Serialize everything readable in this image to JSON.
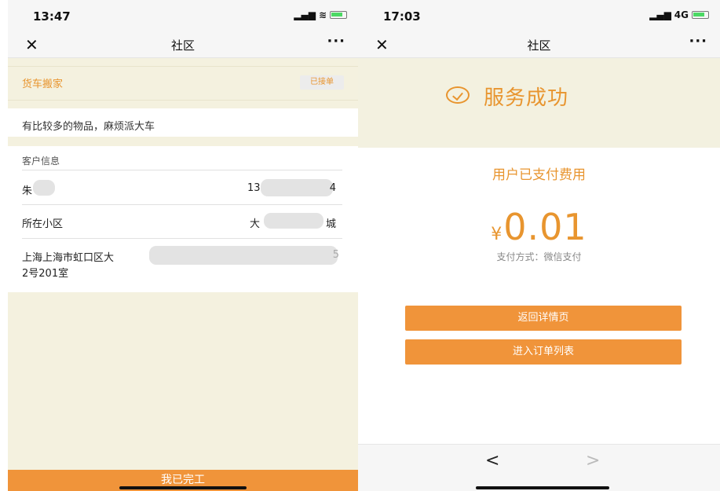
{
  "left_screen": {
    "status_bar": {
      "time": "13:47",
      "signal": "▂▄▆",
      "wifi": "≋"
    },
    "nav": {
      "title": "社区",
      "close": "✕",
      "more": "···"
    },
    "order": {
      "service_type": "货车搬家",
      "status": "已接单",
      "note": "有比较多的物品，麻烦派大车"
    },
    "customer": {
      "section_title": "客户信息",
      "name_visible": "朱",
      "phone_prefix": "13",
      "phone_suffix": "4",
      "community_label": "所在小区",
      "community_prefix": "大",
      "community_suffix": "城",
      "address_line1": "上海上海市虹口区大",
      "address_line1_end": "5",
      "address_line2": "2号201室"
    },
    "bottom_button": "我已完工"
  },
  "right_screen": {
    "status_bar": {
      "time": "17:03",
      "network": "4G"
    },
    "nav": {
      "title": "社区",
      "close": "✕",
      "more": "···"
    },
    "result": {
      "success_text": "服务成功",
      "paid_text": "用户已支付费用",
      "currency": "¥",
      "amount": "0.01",
      "pay_method": "支付方式：微信支付"
    },
    "buttons": {
      "back_detail": "返回详情页",
      "order_list": "进入订单列表"
    },
    "toolbar": {
      "back": "<",
      "forward": ">"
    }
  },
  "colors": {
    "accent": "#f0943a",
    "accent_text": "#e8952f",
    "cream_bg": "#f4f1df"
  }
}
